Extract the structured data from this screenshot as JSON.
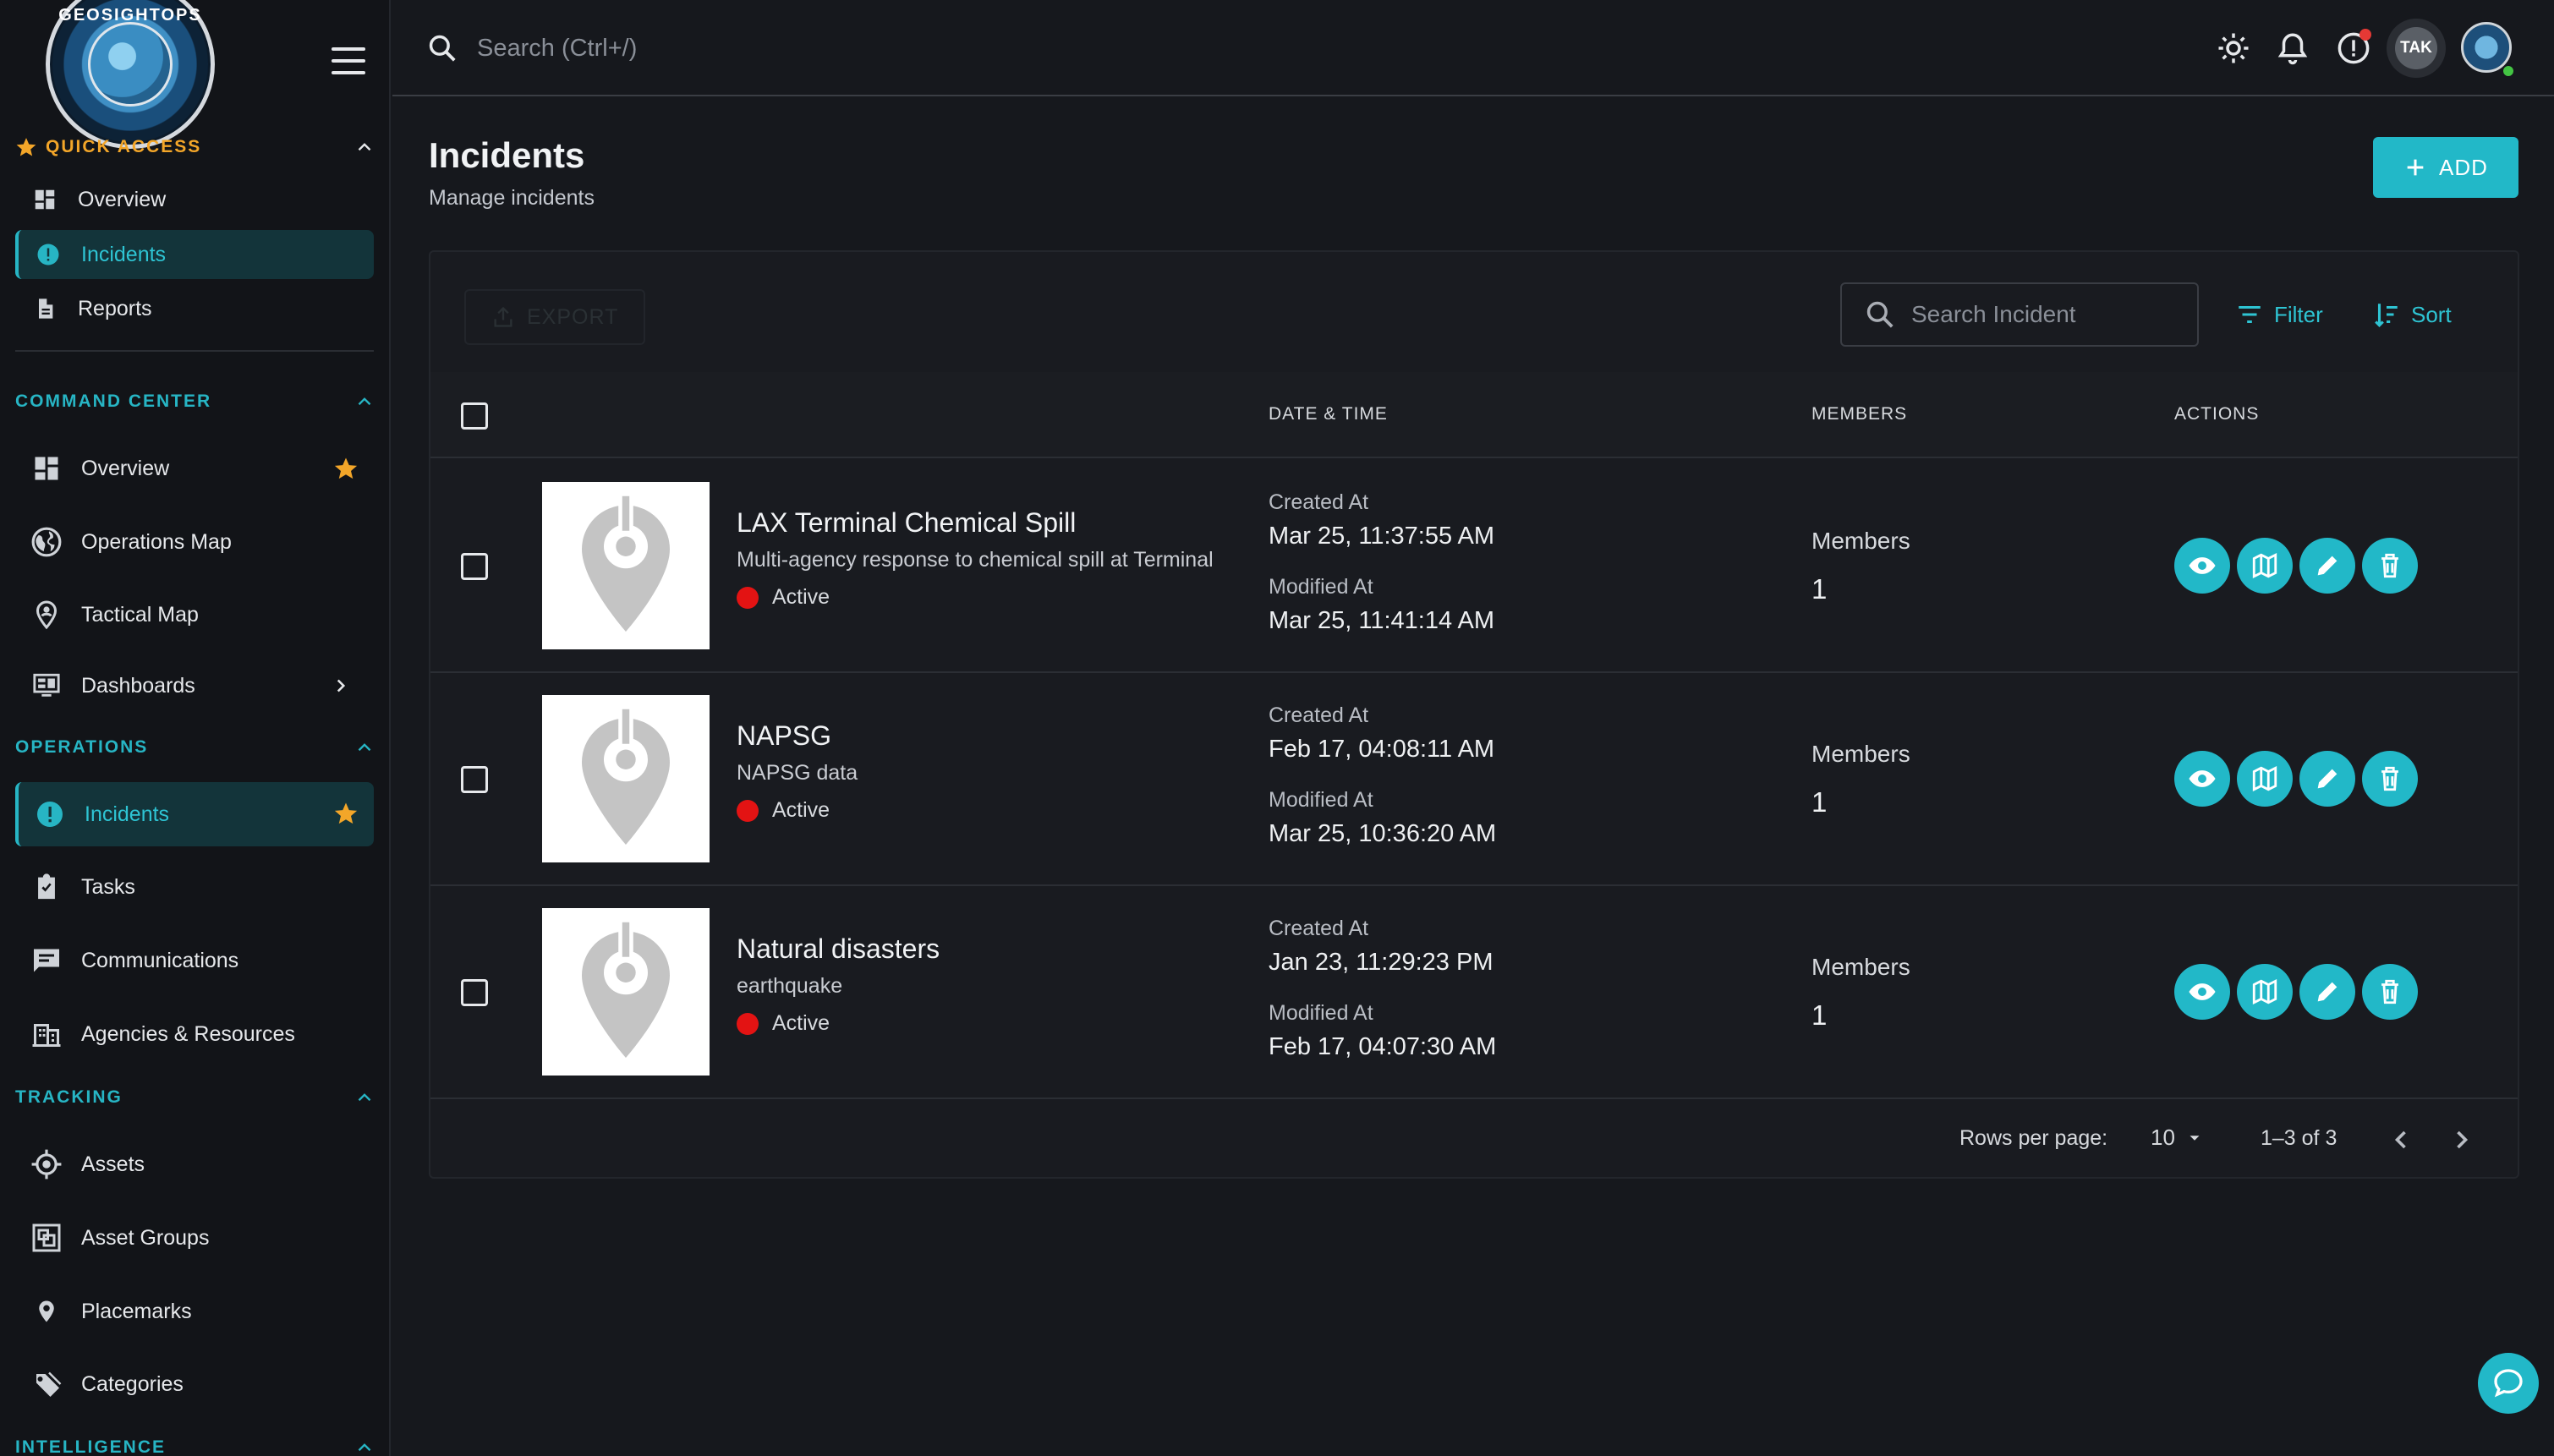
{
  "app": {
    "logo_text": "GEOSIGHTOPS"
  },
  "sidebar": {
    "quick_access": {
      "title": "QUICK ACCESS",
      "items": [
        {
          "label": "Overview",
          "icon": "dashboard-icon"
        },
        {
          "label": "Incidents",
          "icon": "incident-icon",
          "active": true
        },
        {
          "label": "Reports",
          "icon": "document-icon"
        }
      ]
    },
    "command_center": {
      "title": "COMMAND CENTER",
      "items": [
        {
          "label": "Overview",
          "icon": "dashboard-icon",
          "starred": true
        },
        {
          "label": "Operations Map",
          "icon": "globe-icon"
        },
        {
          "label": "Tactical Map",
          "icon": "map-pin-person-icon"
        },
        {
          "label": "Dashboards",
          "icon": "monitor-dashboard-icon",
          "expandable": true
        }
      ]
    },
    "operations": {
      "title": "OPERATIONS",
      "items": [
        {
          "label": "Incidents",
          "icon": "alert-circle-icon",
          "active": true,
          "starred": true
        },
        {
          "label": "Tasks",
          "icon": "clipboard-check-icon"
        },
        {
          "label": "Communications",
          "icon": "chat-icon"
        },
        {
          "label": "Agencies & Resources",
          "icon": "building-icon"
        }
      ]
    },
    "tracking": {
      "title": "TRACKING",
      "items": [
        {
          "label": "Assets",
          "icon": "crosshair-icon"
        },
        {
          "label": "Asset Groups",
          "icon": "group-icon"
        },
        {
          "label": "Placemarks",
          "icon": "location-pin-icon"
        },
        {
          "label": "Categories",
          "icon": "tag-icon"
        }
      ]
    },
    "intelligence": {
      "title": "INTELLIGENCE"
    }
  },
  "topbar": {
    "search_placeholder": "Search (Ctrl+/)",
    "tak_label": "TAK"
  },
  "page": {
    "title": "Incidents",
    "subtitle": "Manage incidents",
    "add_label": "ADD"
  },
  "toolbar": {
    "export_label": "EXPORT",
    "search_placeholder": "Search Incident",
    "filter_label": "Filter",
    "sort_label": "Sort"
  },
  "table": {
    "columns": {
      "datetime": "DATE & TIME",
      "members": "MEMBERS",
      "actions": "ACTIONS"
    },
    "rows": [
      {
        "title": "LAX Terminal Chemical Spill",
        "description": "Multi-agency response to chemical spill at Terminal",
        "status": "Active",
        "created_label": "Created At",
        "created": "Mar 25, 11:37:55 AM",
        "modified_label": "Modified At",
        "modified": "Mar 25, 11:41:14 AM",
        "members_label": "Members",
        "members": "1"
      },
      {
        "title": "NAPSG",
        "description": "NAPSG data",
        "status": "Active",
        "created_label": "Created At",
        "created": "Feb 17, 04:08:11 AM",
        "modified_label": "Modified At",
        "modified": "Mar 25, 10:36:20 AM",
        "members_label": "Members",
        "members": "1"
      },
      {
        "title": "Natural disasters",
        "description": "earthquake",
        "status": "Active",
        "created_label": "Created At",
        "created": "Jan 23, 11:29:23 PM",
        "modified_label": "Modified At",
        "modified": "Feb 17, 04:07:30 AM",
        "members_label": "Members",
        "members": "1"
      }
    ]
  },
  "pagination": {
    "rows_per_page_label": "Rows per page:",
    "rows_per_page": "10",
    "range": "1–3 of 3"
  },
  "colors": {
    "accent": "#22b8c8",
    "quick_access": "#f3a629",
    "status_active": "#e31313",
    "background": "#16181d"
  }
}
